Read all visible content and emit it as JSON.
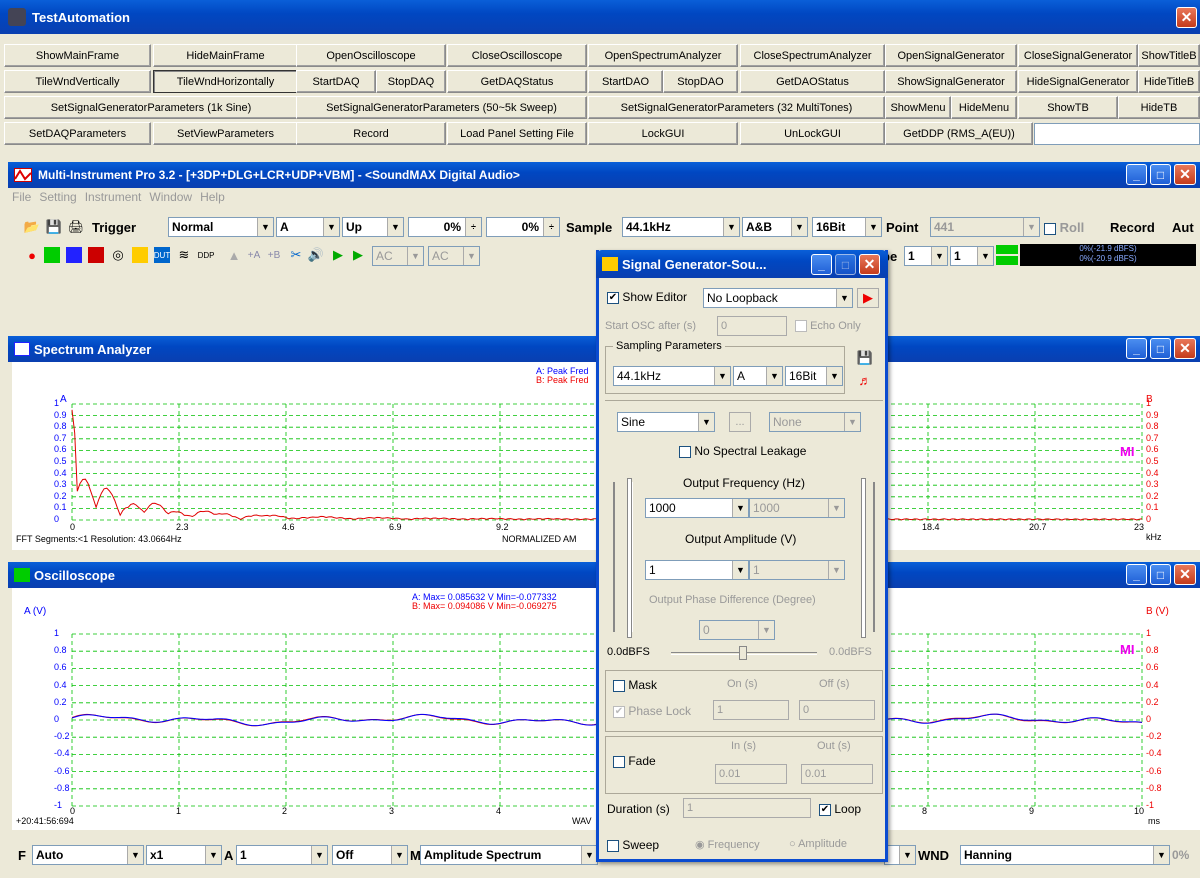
{
  "app": {
    "title": "TestAutomation"
  },
  "buttons": {
    "row1": [
      "ShowMainFrame",
      "HideMainFrame",
      "OpenOscilloscope",
      "CloseOscilloscope",
      "OpenSpectrumAnalyzer",
      "CloseSpectrumAnalyzer",
      "OpenSignalGenerator",
      "CloseSignalGenerator",
      "ShowTitleB"
    ],
    "row2": [
      "TileWndVertically",
      "TileWndHorizontally",
      "StartDAQ",
      "StopDAQ",
      "GetDAQStatus",
      "StartDAO",
      "StopDAO",
      "GetDAOStatus",
      "ShowSignalGenerator",
      "HideSignalGenerator",
      "HideTitleB"
    ],
    "row3": [
      "SetSignalGeneratorParameters (1k Sine)",
      "SetSignalGeneratorParameters (50~5k Sweep)",
      "SetSignalGeneratorParameters (32 MultiTones)",
      "ShowMenu",
      "HideMenu",
      "ShowTB",
      "HideTB"
    ],
    "row4": [
      "SetDAQParameters",
      "SetViewParameters",
      "Record",
      "Load Panel Setting File",
      "LockGUI",
      "UnLockGUI",
      "GetDDP (RMS_A(EU))"
    ]
  },
  "mi": {
    "title": "Multi-Instrument Pro 3.2   -   [+3DP+DLG+LCR+UDP+VBM]   -   <SoundMAX Digital Audio>",
    "menu": [
      "File",
      "Setting",
      "Instrument",
      "Window",
      "Help"
    ],
    "trigger_label": "Trigger",
    "trigger_mode": "Normal",
    "trigger_ch": "A",
    "trigger_edge": "Up",
    "pct1": "0%",
    "pct2": "0%",
    "sample_label": "Sample",
    "sample_rate": "44.1kHz",
    "channels": "A&B",
    "bits": "16Bit",
    "point_label": "Point",
    "point_value": "441",
    "roll_label": "Roll",
    "record_label": "Record",
    "aut_label": "Aut",
    "ac1": "AC",
    "ac2": "AC",
    "pe_label": "pe",
    "pe_val1": "1",
    "pe_val2": "1",
    "level_a": "0%(-21.9 dBFS)",
    "level_b": "0%(-20.9 dBFS)"
  },
  "spectrum": {
    "title": "Spectrum Analyzer",
    "axis_a": "A",
    "axis_b": "B",
    "legend_a": "A: Peak Fred",
    "legend_b": "B: Peak Fred",
    "yticks": [
      "1",
      "0.9",
      "0.8",
      "0.7",
      "0.6",
      "0.5",
      "0.4",
      "0.3",
      "0.2",
      "0.1",
      "0"
    ],
    "xticks": [
      "0",
      "2.3",
      "4.6",
      "6.9",
      "9.2",
      "18.4",
      "20.7",
      "23"
    ],
    "unit": "kHz",
    "footer_left": "FFT Segments:<1    Resolution: 43.0664Hz",
    "footer_mid": "NORMALIZED AM",
    "logo": "MI"
  },
  "osc": {
    "title": "Oscilloscope",
    "axis_a": "A (V)",
    "axis_b": "B (V)",
    "legend_a": "A: Max= 0.085632 V  Min=-0.077332",
    "legend_b": "B: Max= 0.094086 V  Min=-0.069275",
    "yticks": [
      "1",
      "0.8",
      "0.6",
      "0.4",
      "0.2",
      "0",
      "-0.2",
      "-0.4",
      "-0.6",
      "-0.8",
      "-1"
    ],
    "xticks": [
      "0",
      "1",
      "2",
      "3",
      "4",
      "8",
      "9",
      "10"
    ],
    "unit": "ms",
    "footer_left": "+20:41:56:694",
    "footer_mid": "WAV",
    "logo": "MI"
  },
  "siggen": {
    "title": "Signal Generator-Sou...",
    "show_editor": "Show Editor",
    "loopback": "No Loopback",
    "start_osc": "Start OSC after (s)",
    "start_osc_val": "0",
    "echo_only": "Echo Only",
    "sampling_group": "Sampling Parameters",
    "rate": "44.1kHz",
    "channel": "A",
    "bits": "16Bit",
    "waveform": "Sine",
    "ellipsis": "...",
    "wave2": "None",
    "no_leakage": "No Spectral Leakage",
    "freq_label": "Output Frequency (Hz)",
    "freq1": "1000",
    "freq2": "1000",
    "amp_label": "Output Amplitude (V)",
    "amp1": "1",
    "amp2": "1",
    "phase_label": "Output Phase Difference (Degree)",
    "phase_val": "0",
    "dbfs_left": "0.0dBFS",
    "dbfs_right": "0.0dBFS",
    "mask": "Mask",
    "on_s": "On (s)",
    "off_s": "Off (s)",
    "phase_lock": "Phase Lock",
    "pl_val1": "1",
    "pl_val2": "0",
    "fade": "Fade",
    "in_s": "In (s)",
    "out_s": "Out (s)",
    "fade_in": "0.01",
    "fade_out": "0.01",
    "duration": "Duration (s)",
    "duration_val": "1",
    "loop": "Loop",
    "sweep": "Sweep",
    "frequency": "Frequency",
    "amplitude": "Amplitude"
  },
  "bottom": {
    "f_label": "F",
    "f_val": "Auto",
    "x_val": "x1",
    "a_label": "A",
    "a_val": "1",
    "off_val": "Off",
    "m_label": "M",
    "m_val": "Amplitude Spectrum",
    "wnd_label": "WND",
    "wnd_val": "Hanning",
    "pct": "0%"
  },
  "colors": {
    "chA": "#0000ff",
    "chB": "#e00000",
    "grid": "#00c000"
  }
}
